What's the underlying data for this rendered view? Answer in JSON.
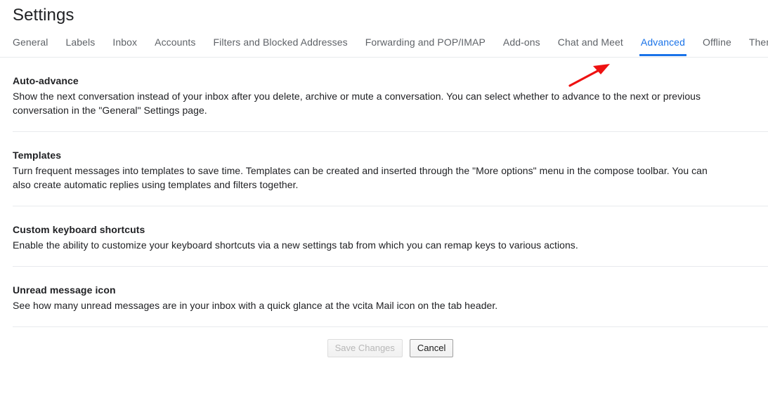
{
  "header": {
    "title": "Settings"
  },
  "tabs": [
    {
      "label": "General",
      "active": false
    },
    {
      "label": "Labels",
      "active": false
    },
    {
      "label": "Inbox",
      "active": false
    },
    {
      "label": "Accounts",
      "active": false
    },
    {
      "label": "Filters and Blocked Addresses",
      "active": false
    },
    {
      "label": "Forwarding and POP/IMAP",
      "active": false
    },
    {
      "label": "Add-ons",
      "active": false
    },
    {
      "label": "Chat and Meet",
      "active": false
    },
    {
      "label": "Advanced",
      "active": true
    },
    {
      "label": "Offline",
      "active": false
    },
    {
      "label": "Themes",
      "active": false
    }
  ],
  "sections": [
    {
      "title": "Auto-advance",
      "description": "Show the next conversation instead of your inbox after you delete, archive or mute a conversation. You can select whether to advance to the next or previous conversation in the \"General\" Settings page."
    },
    {
      "title": "Templates",
      "description": "Turn frequent messages into templates to save time. Templates can be created and inserted through the \"More options\" menu in the compose toolbar. You can also create automatic replies using templates and filters together."
    },
    {
      "title": "Custom keyboard shortcuts",
      "description": "Enable the ability to customize your keyboard shortcuts via a new settings tab from which you can remap keys to various actions."
    },
    {
      "title": "Unread message icon",
      "description": "See how many unread messages are in your inbox with a quick glance at the vcita Mail icon on the tab header."
    }
  ],
  "footer": {
    "save_label": "Save Changes",
    "cancel_label": "Cancel"
  },
  "annotation": {
    "arrow_icon": "red-arrow-icon",
    "color": "#ee1111"
  },
  "colors": {
    "accent": "#1a73e8",
    "text_primary": "#202124",
    "text_secondary": "#5f6368",
    "divider": "#e8eaed",
    "background": "#ffffff"
  }
}
